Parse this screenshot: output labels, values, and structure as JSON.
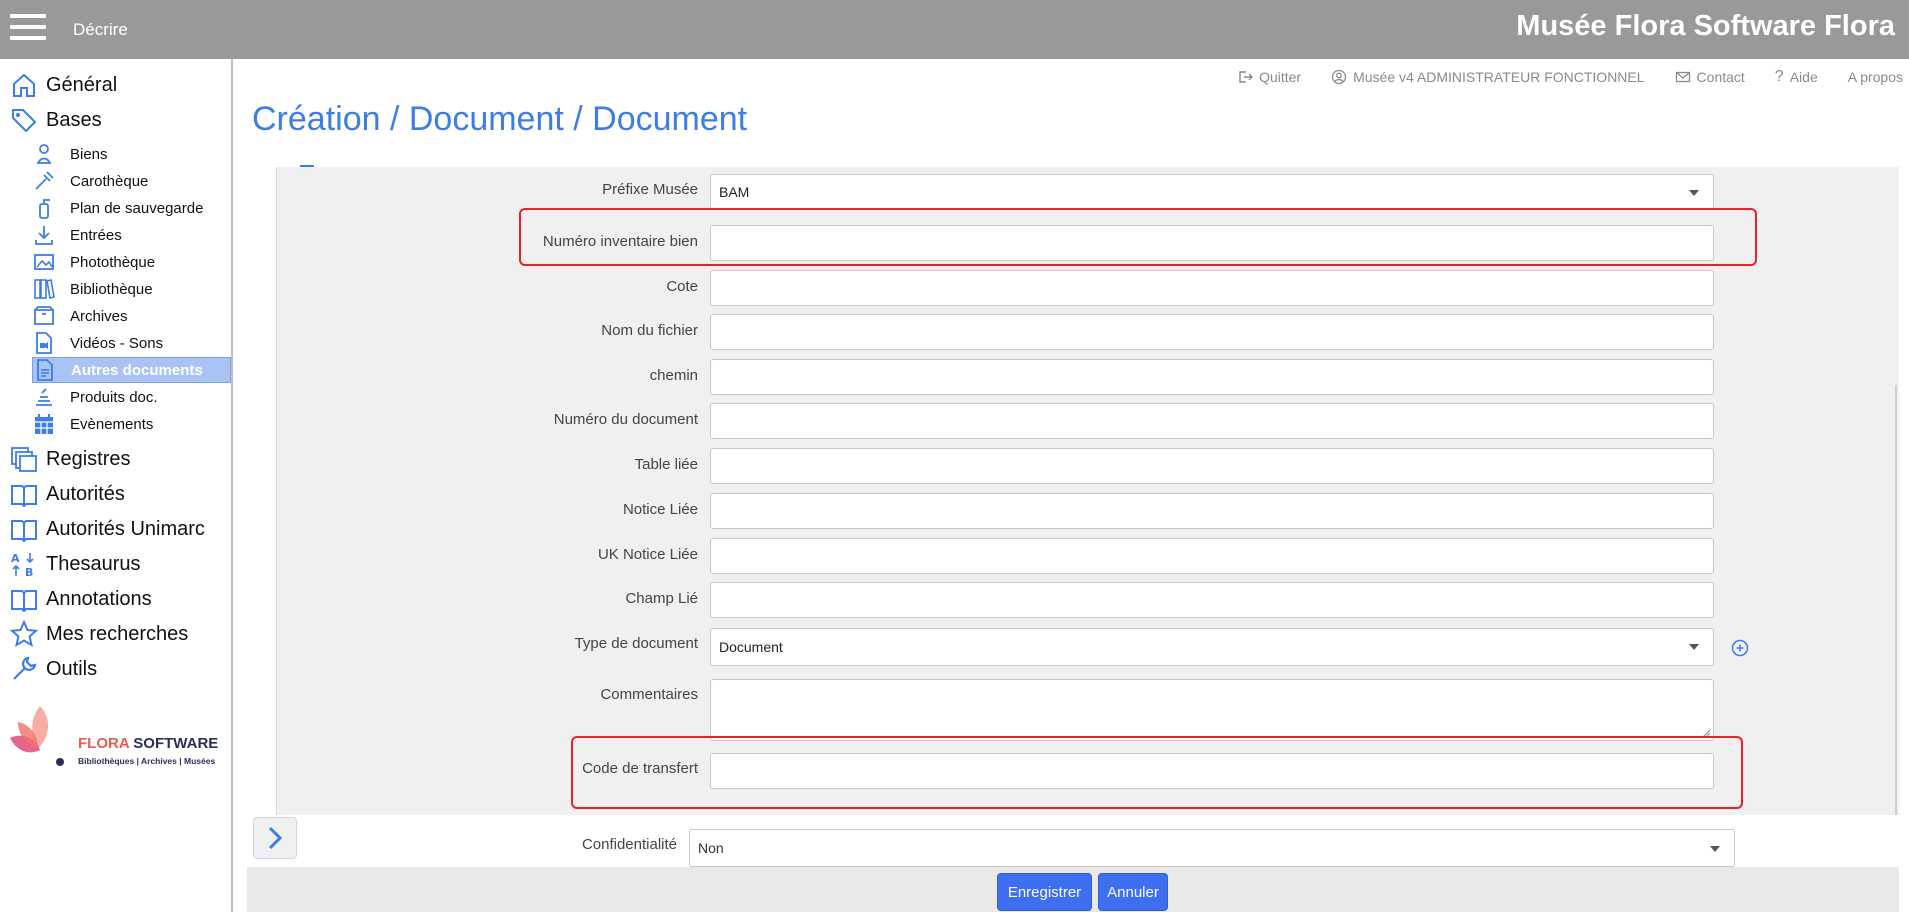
{
  "header": {
    "menu_icon": "hamburger-icon",
    "section": "Décrire",
    "app_title": "Musée Flora Software Flora"
  },
  "toplinks": [
    {
      "label": "Quitter",
      "icon": "exit-icon"
    },
    {
      "label": "Musée v4 ADMINISTRATEUR FONCTIONNEL",
      "icon": "user-icon"
    },
    {
      "label": "Contact",
      "icon": "mail-icon"
    },
    {
      "label": "Aide",
      "icon": "question-icon"
    },
    {
      "label": "A propos",
      "icon": ""
    }
  ],
  "page_title": "Création / Document / Document",
  "sidebar": {
    "general": "Général",
    "bases": "Bases",
    "sub": [
      "Biens",
      "Carothèque",
      "Plan de sauvegarde",
      "Entrées",
      "Photothèque",
      "Bibliothèque",
      "Archives",
      "Vidéos - Sons",
      "Autres documents",
      "Produits doc.",
      "Evènements"
    ],
    "active_sub": "Autres documents",
    "more": [
      "Registres",
      "Autorités",
      "Autorités Unimarc",
      "Thesaurus",
      "Annotations",
      "Mes recherches",
      "Outils"
    ]
  },
  "logo": {
    "brand_a": "FLORA",
    "brand_b": "SOFTWARE",
    "tagline": "Bibliothèques | Archives | Musées"
  },
  "form": {
    "prefixe_label": "Préfixe Musée",
    "prefixe_value": "BAM",
    "numero_bien_label": "Numéro inventaire bien",
    "numero_bien_value": "",
    "cote_label": "Cote",
    "cote_value": "",
    "nom_fichier_label": "Nom du fichier",
    "nom_fichier_value": "",
    "chemin_label": "chemin",
    "chemin_value": "",
    "numero_doc_label": "Numéro du document",
    "numero_doc_value": "",
    "table_liee_label": "Table liée",
    "table_liee_value": "",
    "notice_liee_label": "Notice Liée",
    "notice_liee_value": "",
    "uk_notice_label": "UK Notice Liée",
    "uk_notice_value": "",
    "champ_lie_label": "Champ Lié",
    "champ_lie_value": "",
    "type_doc_label": "Type de document",
    "type_doc_value": "Document",
    "commentaires_label": "Commentaires",
    "commentaires_value": "",
    "code_transfert_label": "Code de transfert",
    "code_transfert_value": "",
    "confidentialite_label": "Confidentialité",
    "confidentialite_value": "Non"
  },
  "buttons": {
    "save": "Enregistrer",
    "cancel": "Annuler"
  },
  "colors": {
    "accent": "#3d7de6",
    "header": "#999999",
    "highlight": "#e8202a",
    "button": "#3d6ff0"
  }
}
